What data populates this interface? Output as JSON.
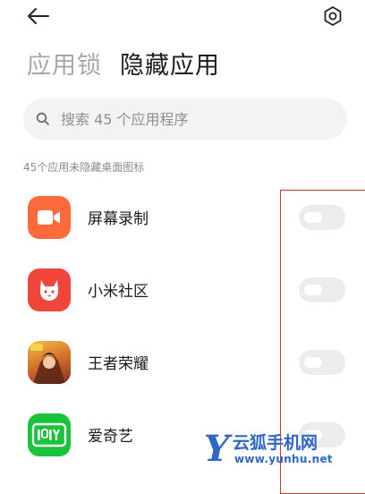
{
  "header": {
    "back_icon": "arrow-left-icon",
    "settings_icon": "gear-icon"
  },
  "tabs": [
    {
      "label": "应用锁",
      "active": false
    },
    {
      "label": "隐藏应用",
      "active": true
    }
  ],
  "search": {
    "placeholder": "搜索 45 个应用程序",
    "value": ""
  },
  "section_label": "45个应用未隐藏桌面图标",
  "apps": [
    {
      "name": "屏幕录制",
      "icon": "video-camera-icon",
      "color": "#ff6a3d",
      "hidden": false
    },
    {
      "name": "小米社区",
      "icon": "mi-bunny-icon",
      "color": "#f0453a",
      "hidden": false
    },
    {
      "name": "王者荣耀",
      "icon": "game-hero-icon",
      "color": "#c9822e",
      "hidden": false
    },
    {
      "name": "爱奇艺",
      "icon": "iqiyi-logo-icon",
      "color": "#19c33a",
      "hidden": false
    }
  ],
  "colors": {
    "highlight_border": "#c9322c",
    "watermark": "#2d67c7"
  },
  "watermark": {
    "letter": "Y",
    "title": "云狐手机网",
    "url": "www.yunhu.net"
  }
}
